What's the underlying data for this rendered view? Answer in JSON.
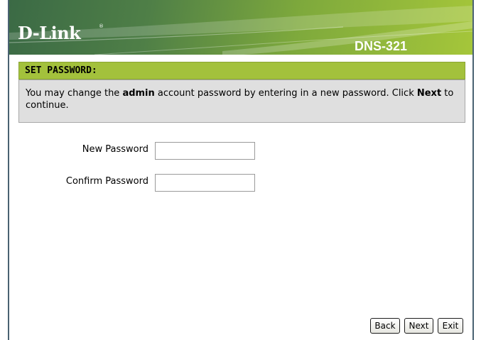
{
  "banner": {
    "brand": "D-Link",
    "registered_mark": "®",
    "model": "DNS-321"
  },
  "section": {
    "title": "SET PASSWORD:"
  },
  "info": {
    "part1": "You may change the ",
    "bold1": "admin",
    "part2": " account password by entering in a new password. Click ",
    "bold2": "Next",
    "part3": " to continue."
  },
  "form": {
    "new_password_label": "New Password",
    "new_password_value": "",
    "confirm_password_label": "Confirm Password",
    "confirm_password_value": ""
  },
  "buttons": {
    "back": "Back",
    "next": "Next",
    "exit": "Exit"
  }
}
